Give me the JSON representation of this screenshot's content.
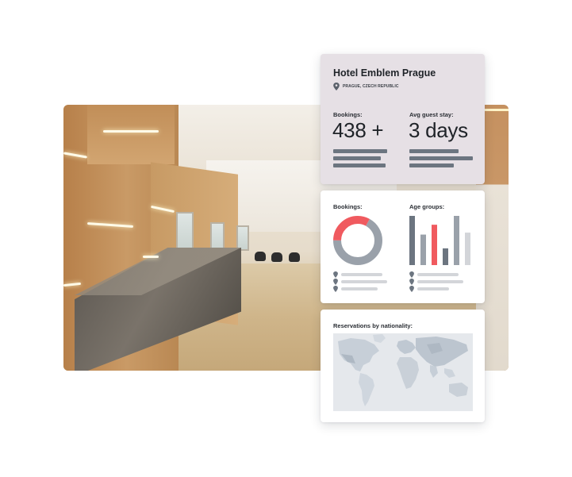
{
  "hotel": {
    "name": "Hotel Emblem Prague",
    "location": "PRAGUE, CZECH REPUBLIC",
    "stats": [
      {
        "label": "Bookings:",
        "value": "438 +"
      },
      {
        "label": "Avg guest stay:",
        "value": "3 days"
      }
    ]
  },
  "charts": {
    "bookings_label": "Bookings:",
    "age_label": "Age groups:"
  },
  "map": {
    "label": "Reservations by nationality:"
  },
  "chart_data": [
    {
      "type": "pie",
      "title": "Bookings:",
      "values": [
        67,
        33
      ],
      "colors": [
        "#9aa1aa",
        "#f05a5f"
      ]
    },
    {
      "type": "bar",
      "title": "Age groups:",
      "values": [
        100,
        62,
        82,
        34,
        100,
        66
      ],
      "colors": [
        "#6c7580",
        "#9aa1aa",
        "#f05a5f",
        "#6c7580",
        "#9aa1aa",
        "#d3d5d9"
      ],
      "ylim": [
        0,
        100
      ]
    }
  ],
  "colors": {
    "accent": "#f05a5f",
    "dark_gray": "#6c7580",
    "mid_gray": "#9aa1aa",
    "light_gray": "#d3d5d9",
    "hotel_card_bg": "#e6e0e5"
  },
  "icons": {
    "location": "map-pin-icon"
  }
}
